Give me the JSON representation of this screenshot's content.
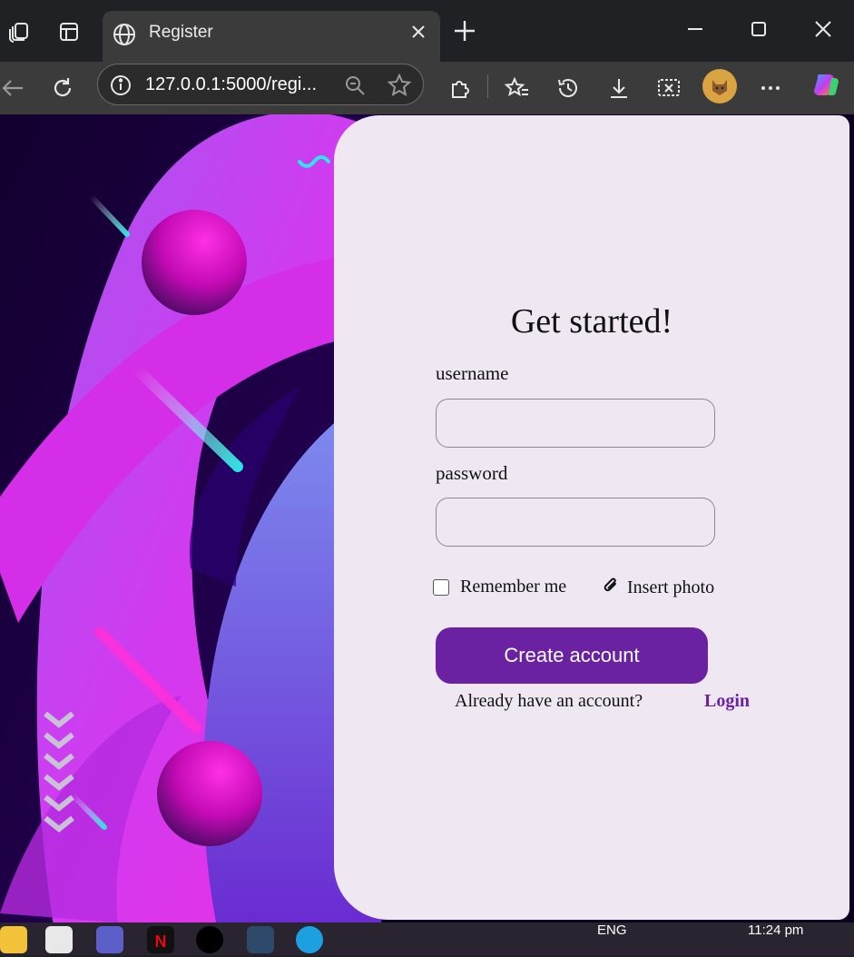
{
  "browser": {
    "tab_title": "Register",
    "url": "127.0.0.1:5000/regi..."
  },
  "form": {
    "heading": "Get started!",
    "username_label": "username",
    "password_label": "password",
    "remember_label": "Remember me",
    "photo_label": "Insert photo",
    "submit_label": "Create account",
    "login_prompt": "Already have an account?",
    "login_link": "Login",
    "username_value": "",
    "password_value": ""
  },
  "taskbar": {
    "language": "ENG",
    "time": "11:24 pm"
  },
  "colors": {
    "accent": "#6a22a3",
    "card_bg": "#efe8f3",
    "browser_dark": "#202124",
    "toolbar": "#3b3b3b"
  },
  "icons": [
    "workspaces-icon",
    "tab-actions-icon",
    "globe-icon",
    "close-icon",
    "new-tab-icon",
    "minimize-icon",
    "maximize-icon",
    "window-close-icon",
    "back-icon",
    "refresh-icon",
    "info-icon",
    "zoom-icon",
    "star-icon",
    "extensions-icon",
    "favorites-icon",
    "history-icon",
    "download-icon",
    "screenshot-icon",
    "profile-avatar",
    "more-icon",
    "copilot-icon",
    "paperclip-icon"
  ]
}
